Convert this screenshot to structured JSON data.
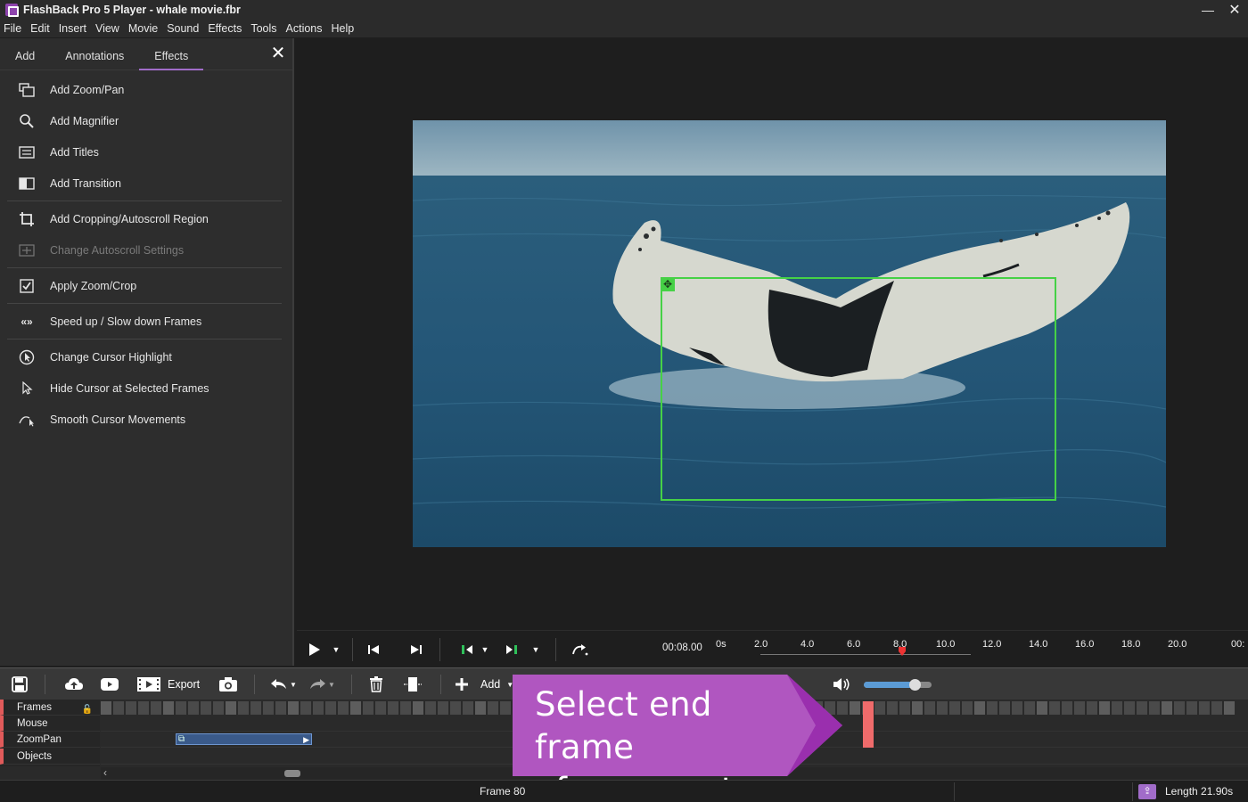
{
  "window": {
    "title": "FlashBack Pro 5 Player - whale movie.fbr",
    "minimize": "—",
    "close": "✕"
  },
  "menu": [
    "File",
    "Edit",
    "Insert",
    "View",
    "Movie",
    "Sound",
    "Effects",
    "Tools",
    "Actions",
    "Help"
  ],
  "panel": {
    "tabs": [
      "Add",
      "Annotations",
      "Effects"
    ],
    "active_tab": "Effects",
    "close": "✕",
    "items": [
      {
        "label": "Add Zoom/Pan",
        "icon": "zoom-pan-icon"
      },
      {
        "label": "Add Magnifier",
        "icon": "magnifier-icon"
      },
      {
        "label": "Add Titles",
        "icon": "titles-icon"
      },
      {
        "label": "Add Transition",
        "icon": "transition-icon"
      },
      {
        "label": "Add Cropping/Autoscroll Region",
        "icon": "crop-icon"
      },
      {
        "label": "Change Autoscroll Settings",
        "icon": "autoscroll-icon",
        "disabled": true
      },
      {
        "label": "Apply Zoom/Crop",
        "icon": "checkbox-icon"
      },
      {
        "label": "Speed up / Slow down Frames",
        "icon": "speed-icon"
      },
      {
        "label": "Change Cursor Highlight",
        "icon": "cursor-highlight-icon"
      },
      {
        "label": "Hide Cursor at Selected Frames",
        "icon": "cursor-icon"
      },
      {
        "label": "Smooth Cursor Movements",
        "icon": "smooth-cursor-icon"
      }
    ]
  },
  "player": {
    "time": "00:08.00",
    "ruler_labels": [
      "0s",
      "2.0",
      "4.0",
      "6.0",
      "8.0",
      "10.0",
      "12.0",
      "14.0",
      "16.0",
      "18.0",
      "20.0",
      "00:"
    ],
    "playhead_seconds": 8.0
  },
  "toolbar": {
    "export_label": "Export",
    "add_label": "Add",
    "volume_level": 0.75
  },
  "timeline": {
    "tracks": [
      "Frames",
      "Mouse",
      "ZoomPan",
      "Objects"
    ],
    "selected_frame_marker": "frame 80"
  },
  "callout": {
    "text_line1": "Select end frame",
    "text_line2": "of zoom out",
    "color": "#b056c0"
  },
  "status": {
    "frame": "Frame 80",
    "length": "Length 21.90s"
  },
  "colors": {
    "accent": "#a16cc9",
    "zoom_rect": "#46d146",
    "marker": "#ef6b6b"
  }
}
